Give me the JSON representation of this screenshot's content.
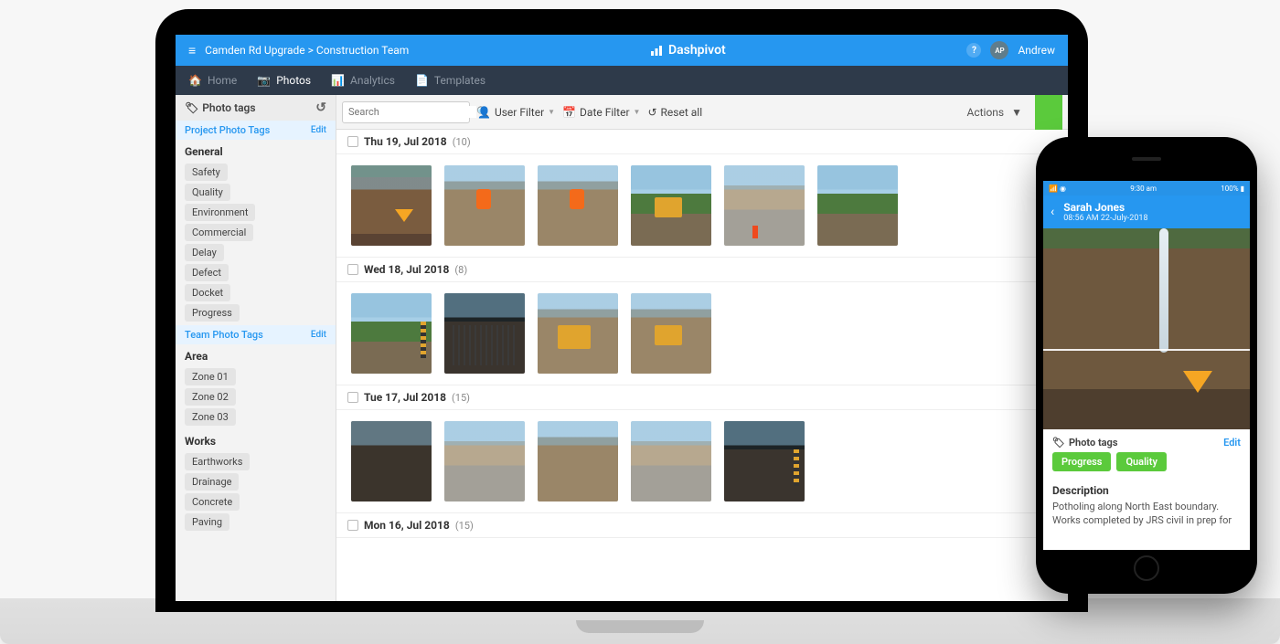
{
  "topbar": {
    "breadcrumb": "Camden Rd Upgrade > Construction Team",
    "app_name": "Dashpivot",
    "user_initials": "AP",
    "user_name": "Andrew"
  },
  "nav": {
    "home": "Home",
    "photos": "Photos",
    "analytics": "Analytics",
    "templates": "Templates"
  },
  "sidebar": {
    "header": "Photo tags",
    "project_section": "Project Photo Tags",
    "team_section": "Team Photo Tags",
    "edit_label": "Edit",
    "general_label": "General",
    "general_tags": [
      "Safety",
      "Quality",
      "Environment",
      "Commercial",
      "Delay",
      "Defect",
      "Docket",
      "Progress"
    ],
    "area_label": "Area",
    "area_tags": [
      "Zone 01",
      "Zone 02",
      "Zone 03"
    ],
    "works_label": "Works",
    "works_tags": [
      "Earthworks",
      "Drainage",
      "Concrete",
      "Paving"
    ]
  },
  "toolbar": {
    "search_placeholder": "Search",
    "user_filter": "User Filter",
    "date_filter": "Date Filter",
    "reset_all": "Reset all",
    "actions": "Actions"
  },
  "groups": [
    {
      "date": "Thu 19, Jul 2018",
      "count": "(10)",
      "thumbs": 6
    },
    {
      "date": "Wed 18, Jul 2018",
      "count": "(8)",
      "thumbs": 4
    },
    {
      "date": "Tue 17, Jul 2018",
      "count": "(15)",
      "thumbs": 5
    },
    {
      "date": "Mon 16, Jul 2018",
      "count": "(15)",
      "thumbs": 0
    }
  ],
  "phone": {
    "status_time": "9:30 am",
    "status_batt": "100%",
    "user": "Sarah Jones",
    "timestamp": "08:56 AM 22-July-2018",
    "tags_title": "Photo tags",
    "edit_label": "Edit",
    "applied": [
      "Progress",
      "Quality"
    ],
    "desc_title": "Description",
    "desc_text": "Potholing along North East boundary. Works completed by JRS civil in prep for"
  }
}
